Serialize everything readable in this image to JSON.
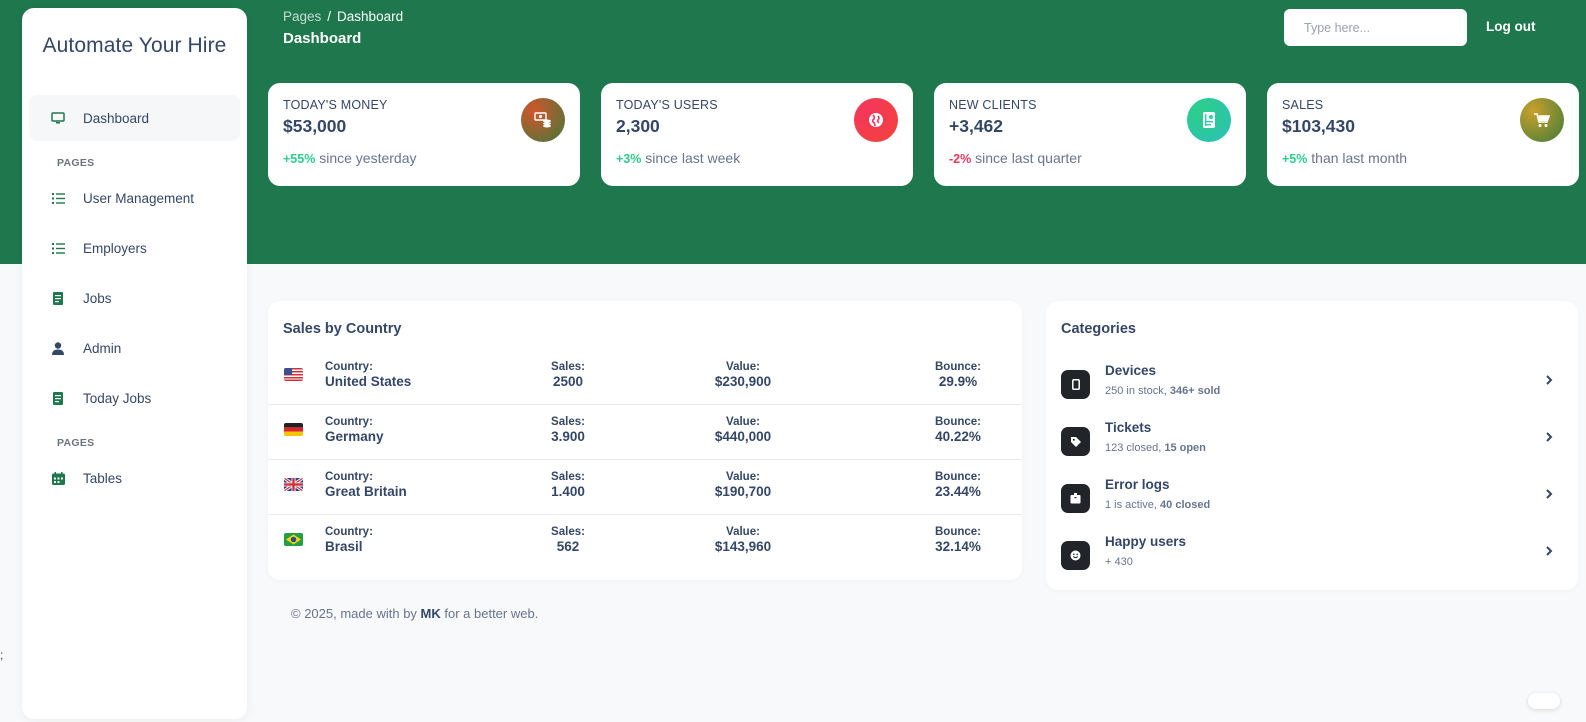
{
  "brand": "Automate Your Hire",
  "sidebar": {
    "items": [
      {
        "label": "Dashboard",
        "icon": "monitor-icon"
      },
      {
        "section": "PAGES"
      },
      {
        "label": "User Management",
        "icon": "list-icon"
      },
      {
        "label": "Employers",
        "icon": "list-icon"
      },
      {
        "label": "Jobs",
        "icon": "document-icon"
      },
      {
        "label": "Admin",
        "icon": "user-icon"
      },
      {
        "label": "Today Jobs",
        "icon": "document-icon"
      },
      {
        "section": "PAGES"
      },
      {
        "label": "Tables",
        "icon": "calendar-icon"
      }
    ]
  },
  "header": {
    "breadcrumb_root": "Pages",
    "breadcrumb_sep": "/",
    "breadcrumb_current": "Dashboard",
    "title": "Dashboard",
    "search_placeholder": "Type here...",
    "logout": "Log out"
  },
  "stats": [
    {
      "title": "TODAY'S MONEY",
      "value": "$53,000",
      "change": "+55%",
      "change_type": "positive",
      "note": " since yesterday",
      "icon": "money-icon",
      "icon_color": "#c0602e"
    },
    {
      "title": "TODAY'S USERS",
      "value": "2,300",
      "change": "+3%",
      "change_type": "positive",
      "note": " since last week",
      "icon": "globe-icon",
      "icon_color": "#f5365c"
    },
    {
      "title": "NEW CLIENTS",
      "value": "+3,462",
      "change": "-2%",
      "change_type": "negative",
      "note": " since last quarter",
      "icon": "document-icon",
      "icon_color": "#2dceb0"
    },
    {
      "title": "SALES",
      "value": "$103,430",
      "change": "+5%",
      "change_type": "positive",
      "note": " than last month",
      "icon": "cart-icon",
      "icon_color": "#a78a2a"
    }
  ],
  "sales_by_country": {
    "title": "Sales by Country",
    "labels": {
      "country": "Country:",
      "sales": "Sales:",
      "value": "Value:",
      "bounce": "Bounce:"
    },
    "rows": [
      {
        "flag": "us",
        "country": "United States",
        "sales": "2500",
        "value": "$230,900",
        "bounce": "29.9%"
      },
      {
        "flag": "de",
        "country": "Germany",
        "sales": "3.900",
        "value": "$440,000",
        "bounce": "40.22%"
      },
      {
        "flag": "gb",
        "country": "Great Britain",
        "sales": "1.400",
        "value": "$190,700",
        "bounce": "23.44%"
      },
      {
        "flag": "br",
        "country": "Brasil",
        "sales": "562",
        "value": "$143,960",
        "bounce": "32.14%"
      }
    ]
  },
  "categories": {
    "title": "Categories",
    "items": [
      {
        "name": "Devices",
        "desc_a": "250 in stock, ",
        "desc_b": "346+ sold",
        "icon": "mobile-icon"
      },
      {
        "name": "Tickets",
        "desc_a": "123 closed, ",
        "desc_b": "15 open",
        "icon": "tag-icon"
      },
      {
        "name": "Error logs",
        "desc_a": "1 is active, ",
        "desc_b": "40 closed",
        "icon": "box-icon"
      },
      {
        "name": "Happy users",
        "desc_a": "+ 430",
        "desc_b": "",
        "icon": "smile-icon"
      }
    ]
  },
  "footer": {
    "prefix": "© 2025, made with by ",
    "author": "MK",
    "suffix": " for a better web."
  },
  "stray_text": ";"
}
